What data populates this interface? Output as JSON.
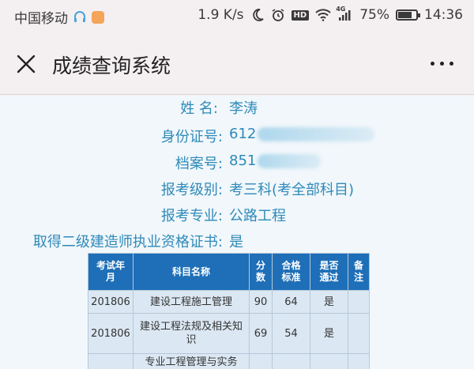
{
  "status_bar": {
    "carrier": "中国移动",
    "speed": "1.9 K/s",
    "hd": "HD",
    "network": "4G",
    "battery": "75%",
    "battery_level": 0.75,
    "time": "14:36"
  },
  "header": {
    "title": "成绩查询系统"
  },
  "info": {
    "name_label": "姓 名:",
    "name": "李涛",
    "id_label": "身份证号:",
    "id_value": "612",
    "file_label": "档案号:",
    "file_value": "851",
    "level_label": "报考级别:",
    "level_value": "考三科(考全部科目)",
    "major_label": "报考专业:",
    "major_value": "公路工程",
    "cert_label": "取得二级建造师执业资格证书:",
    "cert_value": "是"
  },
  "table": {
    "headers": {
      "year": [
        "考试年",
        "月"
      ],
      "subject": "科目名称",
      "score": [
        "分",
        "数"
      ],
      "pass_line": [
        "合格",
        "标准"
      ],
      "passed": [
        "是否",
        "通过"
      ],
      "remark": [
        "备",
        "注"
      ]
    },
    "rows": [
      {
        "year": "201806",
        "subject": [
          "建设工程施工管理"
        ],
        "score": "90",
        "pass_line": "64",
        "passed": "是",
        "remark": ""
      },
      {
        "year": "201806",
        "subject": [
          "建设工程法规及相关知",
          "识"
        ],
        "score": "69",
        "pass_line": "54",
        "passed": "是",
        "remark": ""
      },
      {
        "year": "",
        "subject": [
          "专业工程管理与实务"
        ],
        "score": "",
        "pass_line": "",
        "passed": "",
        "remark": ""
      }
    ]
  }
}
